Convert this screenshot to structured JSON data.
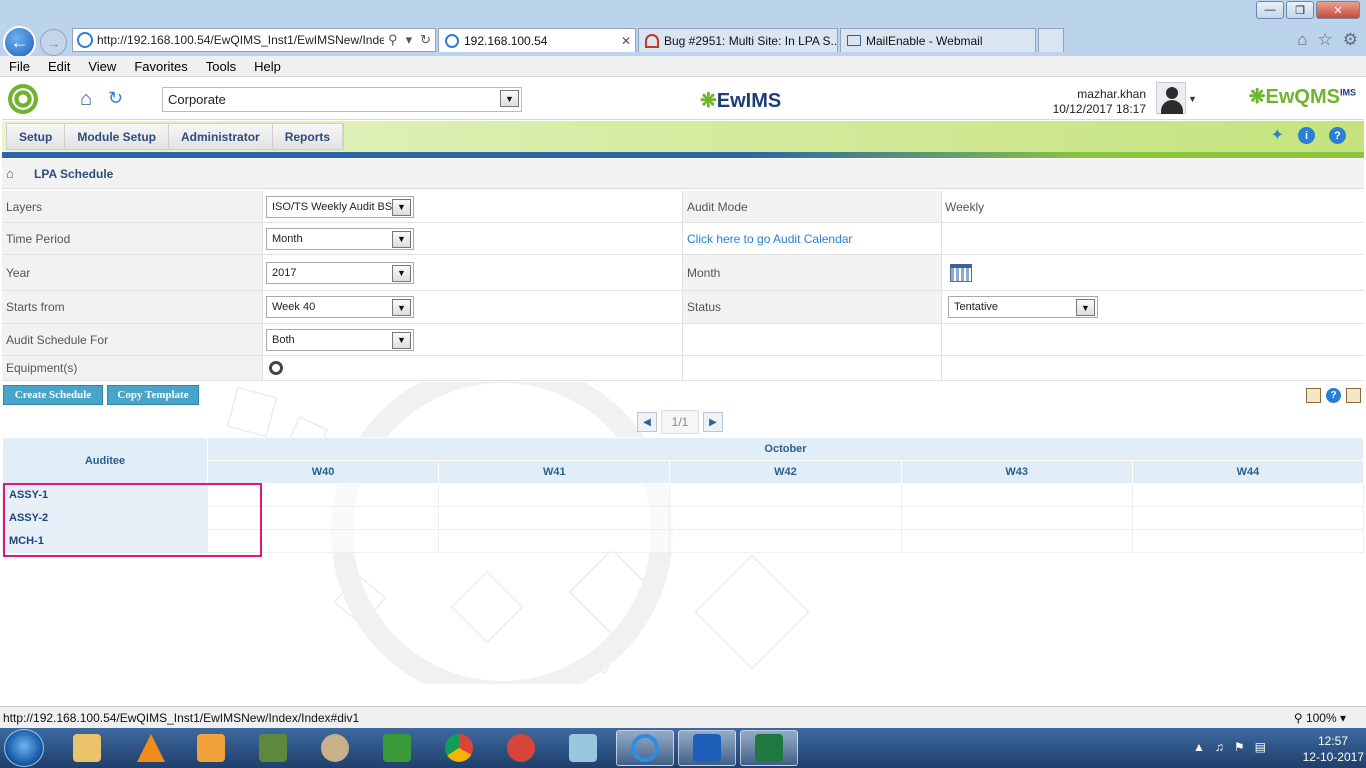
{
  "browser": {
    "window_title": "",
    "address": "http://192.168.100.54/EwQIMS_Inst1/EwIMSNew/Inde",
    "tabs": [
      {
        "label": "192.168.100.54"
      },
      {
        "label": "Bug #2951: Multi Site: In LPA S..."
      },
      {
        "label": "MailEnable - Webmail"
      }
    ],
    "menu": [
      "File",
      "Edit",
      "View",
      "Favorites",
      "Tools",
      "Help"
    ]
  },
  "header": {
    "org_select": "Corporate",
    "center_logo": "EwIMS",
    "user_name": "mazhar.khan",
    "user_datetime": "10/12/2017 18:17",
    "right_logo": "EwQMS",
    "right_logo_sup": "IMS"
  },
  "nav": {
    "items": [
      "Setup",
      "Module Setup",
      "Administrator",
      "Reports"
    ]
  },
  "breadcrumb": {
    "title": "LPA Schedule"
  },
  "form": {
    "layers_label": "Layers",
    "layers_value": "ISO/TS Weekly Audit BS",
    "audit_mode_label": "Audit Mode",
    "audit_mode_value": "Weekly",
    "time_period_label": "Time Period",
    "time_period_value": "Month",
    "calendar_link": "Click here to go Audit Calendar",
    "year_label": "Year",
    "year_value": "2017",
    "month_label": "Month",
    "starts_from_label": "Starts from",
    "starts_from_value": "Week 40",
    "status_label": "Status",
    "status_value": "Tentative",
    "schedule_for_label": "Audit Schedule For",
    "schedule_for_value": "Both",
    "equipment_label": "Equipment(s)"
  },
  "actions": {
    "create": "Create Schedule",
    "copy": "Copy Template"
  },
  "pager": {
    "page": "1/1"
  },
  "grid": {
    "auditee_header": "Auditee",
    "month": "October",
    "weeks": [
      "W40",
      "W41",
      "W42",
      "W43",
      "W44"
    ],
    "rows": [
      "ASSY-1",
      "ASSY-2",
      "MCH-1"
    ]
  },
  "status": {
    "url": "http://192.168.100.54/EwQIMS_Inst1/EwIMSNew/Index/Index#div1",
    "zoom": "100%"
  },
  "taskbar": {
    "time": "12:57",
    "date": "12-10-2017"
  },
  "colors": {
    "accent": "#2a7fd4",
    "button": "#4aa3c9",
    "highlight": "#e0177a",
    "nav_green": "#8cc63f"
  }
}
